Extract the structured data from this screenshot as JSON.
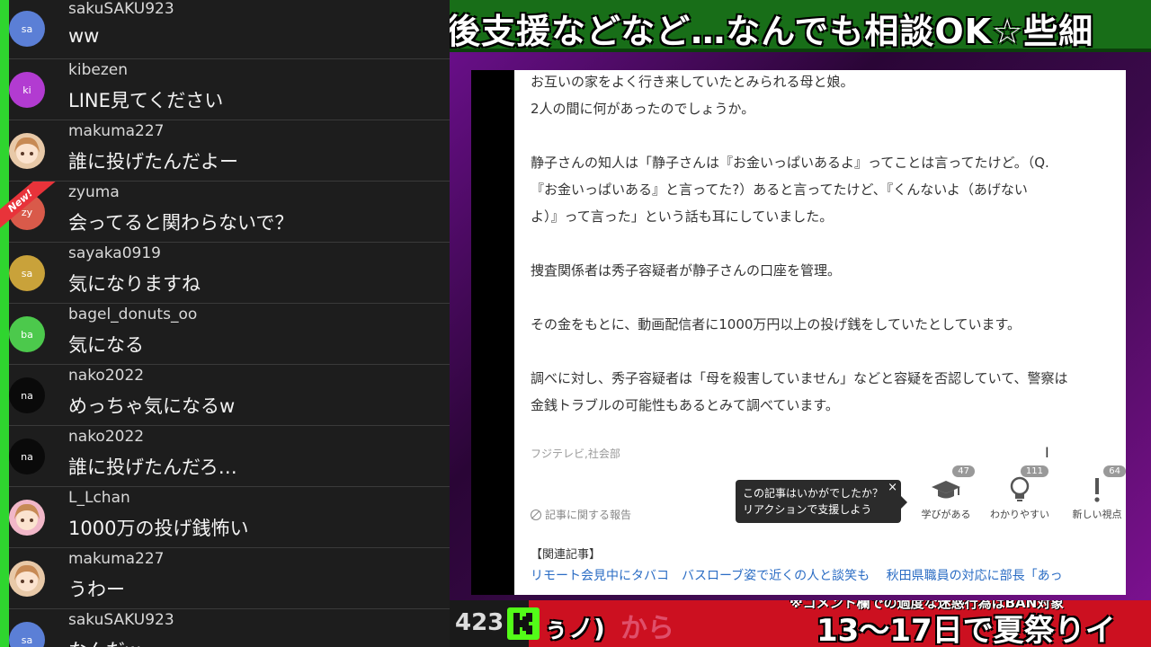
{
  "chat": {
    "messages": [
      {
        "user": "sakuSAKU923",
        "text": "ww",
        "initials": "sa",
        "avatar_color": "#5b7fd6"
      },
      {
        "user": "kibezen",
        "text": "LINE見てください",
        "initials": "ki",
        "avatar_color": "#b23bd1"
      },
      {
        "user": "makuma227",
        "text": "誰に投げたんだよー",
        "initials": "",
        "avatar_color": "#e8c9a8"
      },
      {
        "user": "zyuma",
        "text": "会ってると関わらないで？",
        "initials": "zy",
        "avatar_color": "#d95a4a",
        "new": "New!"
      },
      {
        "user": "sayaka0919",
        "text": "気になりますね",
        "initials": "sa",
        "avatar_color": "#c9a23a"
      },
      {
        "user": "bagel_donuts_oo",
        "text": "気になる",
        "initials": "ba",
        "avatar_color": "#4cc94c"
      },
      {
        "user": "nako2022",
        "text": "めっちゃ気になるw",
        "initials": "na",
        "avatar_color": "#0a0a0a"
      },
      {
        "user": "nako2022",
        "text": "誰に投げたんだろ…",
        "initials": "na",
        "avatar_color": "#0a0a0a"
      },
      {
        "user": "L_Lchan",
        "text": "1000万の投げ銭怖い",
        "initials": "",
        "avatar_color": "#f1b7c8"
      },
      {
        "user": "makuma227",
        "text": "うわー",
        "initials": "",
        "avatar_color": "#e8c9a8"
      },
      {
        "user": "sakuSAKU923",
        "text": "なんだw",
        "initials": "sa",
        "avatar_color": "#5b7fd6"
      }
    ]
  },
  "stream": {
    "ticker_top": "後支援などなど…なんでも相談OK☆些細",
    "article": {
      "paragraphs": [
        "お互いの家をよく行き来していたとみられる母と娘。",
        "2人の間に何があったのでしょうか。",
        "",
        "静子さんの知人は「静子さんは『お金いっぱいあるよ』ってことは言ってたけど。（Q.",
        "『お金いっぱいある』と言ってた?）あると言ってたけど、『くんないよ（あげない",
        "よ）』って言った」という話も耳にしていました。",
        "",
        "捜査関係者は秀子容疑者が静子さんの口座を管理。",
        "",
        "その金をもとに、動画配信者に1000万円以上の投げ銭をしていたとしています。",
        "",
        "調べに対し、秀子容疑者は「母を殺害していません」などと容疑を否認していて、警察は",
        "金銭トラブルの可能性もあるとみて調べています。"
      ],
      "source": "フジテレビ,社会部",
      "report_label": "記事に関する報告",
      "tooltip_line1": "この記事はいかがでしたか？",
      "tooltip_line2": "リアクションで支援しよう",
      "tooltip_close": "×",
      "reactions": [
        {
          "label": "学びがある",
          "count": "47",
          "icon": "graduation-cap-icon"
        },
        {
          "label": "わかりやすい",
          "count": "111",
          "icon": "lightbulb-icon"
        },
        {
          "label": "新しい視点",
          "count": "64",
          "icon": "exclamation-icon"
        }
      ],
      "related_heading": "【関連記事】",
      "related_links": [
        "リモート会見中にタバコ　バスローブ姿で近くの人と談笑も",
        "秋田県職員の対応に部長「あっ"
      ]
    },
    "bottom": {
      "viewers": "423",
      "fragment": "ぅノ)",
      "fragment2": "から",
      "notice": "※コメント欄での過度な迷惑行為はBAN対象",
      "ticker": "13〜17日で夏祭りイ"
    },
    "colors": {
      "chat_accent": "#2fd52f",
      "ticker_top_bg": "#186e18",
      "bottom_bg": "#cc1020",
      "kick_green": "#53fc18",
      "link": "#2a6cc4"
    }
  }
}
